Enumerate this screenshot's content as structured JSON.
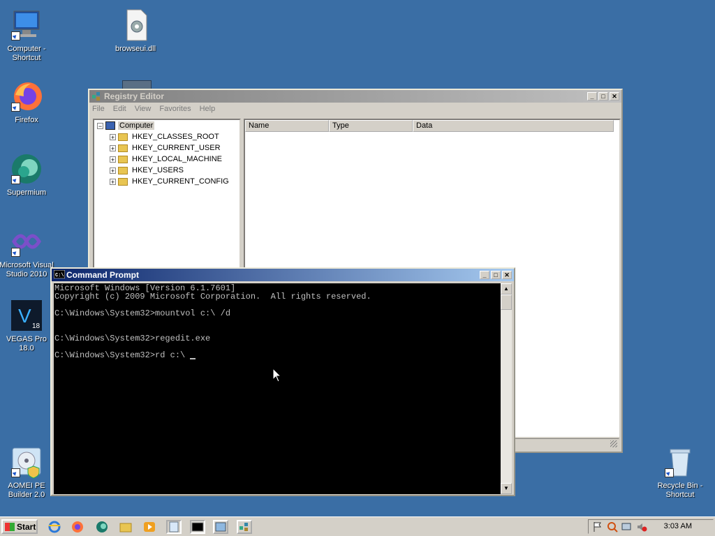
{
  "desktop": {
    "icons": [
      {
        "label": "Computer -\nShortcut"
      },
      {
        "label": "browseui.dll"
      },
      {
        "label": "Firefox"
      },
      {
        "label": "Supermium"
      },
      {
        "label": "Microsoft Visual\nStudio 2010"
      },
      {
        "label": "VEGAS Pro\n18.0"
      },
      {
        "label": "AOMEI PE\nBuilder 2.0"
      },
      {
        "label": "Recycle Bin -\nShortcut"
      }
    ]
  },
  "regedit": {
    "title": "Registry Editor",
    "menu": [
      "File",
      "Edit",
      "View",
      "Favorites",
      "Help"
    ],
    "tree": {
      "root": "Computer",
      "hives": [
        "HKEY_CLASSES_ROOT",
        "HKEY_CURRENT_USER",
        "HKEY_LOCAL_MACHINE",
        "HKEY_USERS",
        "HKEY_CURRENT_CONFIG"
      ]
    },
    "columns": [
      "Name",
      "Type",
      "Data"
    ]
  },
  "cmd": {
    "title": "Command Prompt",
    "lines": [
      "Microsoft Windows [Version 6.1.7601]",
      "Copyright (c) 2009 Microsoft Corporation.  All rights reserved.",
      "",
      "C:\\Windows\\System32>mountvol c:\\ /d",
      "",
      "",
      "C:\\Windows\\System32>regedit.exe",
      "",
      "C:\\Windows\\System32>rd c:\\ "
    ]
  },
  "taskbar": {
    "start_label": "Start",
    "clock": "3:03 AM"
  },
  "window_controls": {
    "minimize": "_",
    "maximize": "□",
    "close": "✕"
  },
  "colors": {
    "desktop": "#3a6ea5",
    "active_title": "#0a246a",
    "console_bg": "#000000"
  }
}
